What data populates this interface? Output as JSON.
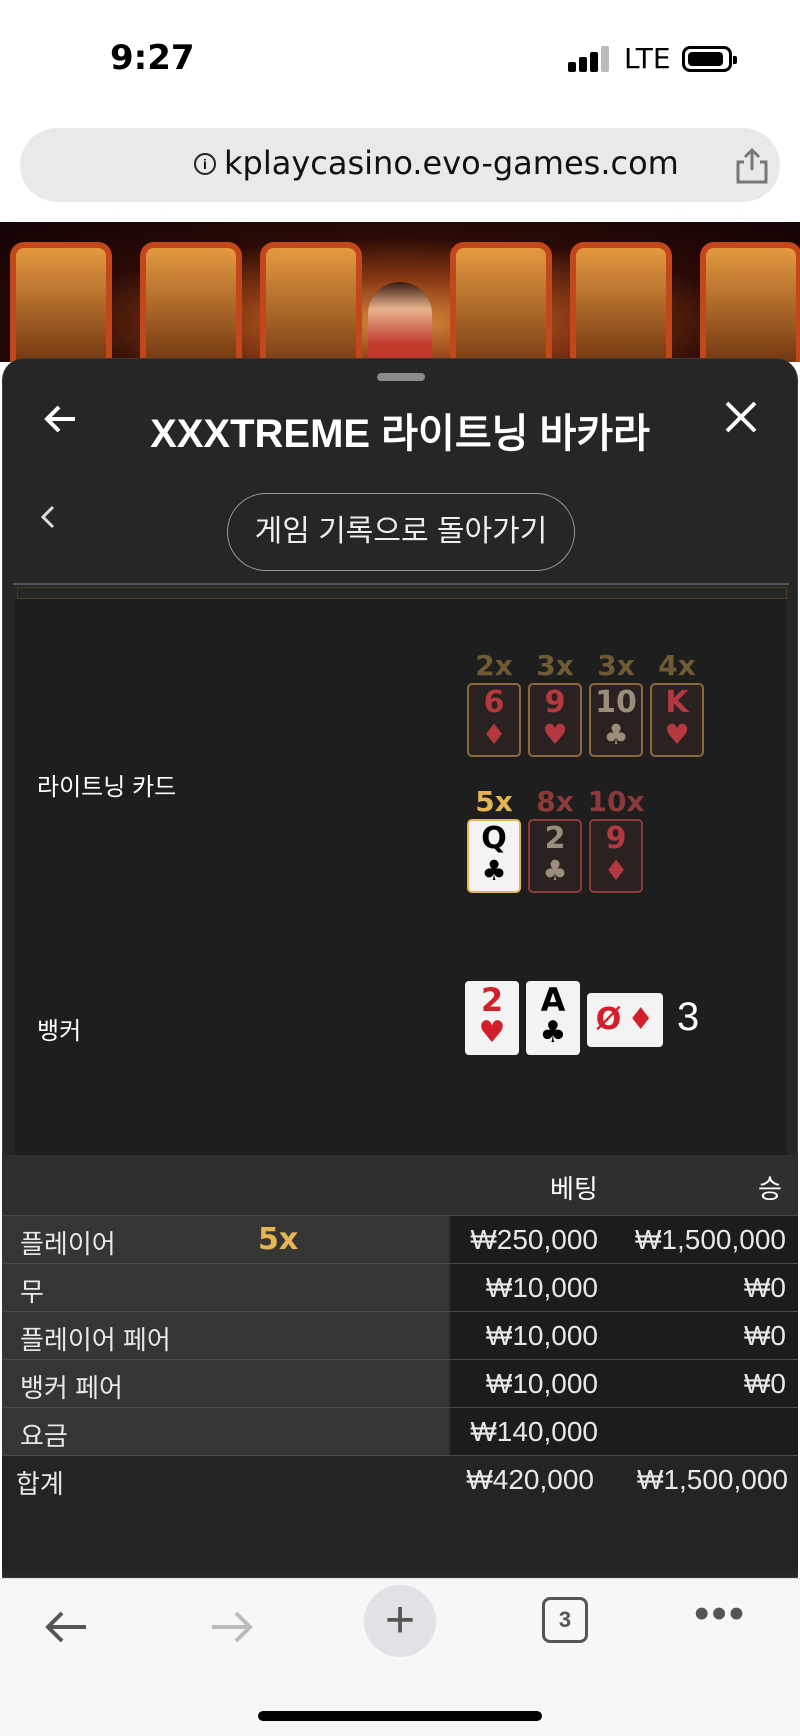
{
  "status_bar": {
    "time": "9:27",
    "network": "LTE"
  },
  "url_bar": {
    "url": "kplaycasino.evo-games.com"
  },
  "sheet": {
    "title": "XXXTREME 라이트닝 바카라",
    "history_button": "게임 기록으로 돌아가기"
  },
  "lightning": {
    "label": "라이트닝 카드",
    "row1": [
      {
        "mult": "2x",
        "rank": "6",
        "suit": "♦",
        "color": "#b3383f"
      },
      {
        "mult": "3x",
        "rank": "9",
        "suit": "♥",
        "color": "#b3383f"
      },
      {
        "mult": "3x",
        "rank": "10",
        "suit": "♣",
        "color": "#9a8d7a"
      },
      {
        "mult": "4x",
        "rank": "K",
        "suit": "♥",
        "color": "#b3383f"
      }
    ],
    "row2": [
      {
        "mult": "5x",
        "rank": "Q",
        "suit": "♣",
        "color": "#000000",
        "highlighted": true
      },
      {
        "mult": "8x",
        "rank": "2",
        "suit": "♣",
        "color": "#9a8d7a"
      },
      {
        "mult": "10x",
        "rank": "9",
        "suit": "♦",
        "color": "#b3383f"
      }
    ]
  },
  "banker": {
    "label": "뱅커",
    "cards": [
      {
        "rank": "2",
        "suit": "♥",
        "color": "#d21f2a"
      },
      {
        "rank": "A",
        "suit": "♣",
        "color": "#000000"
      }
    ],
    "side_card": {
      "rank": "Ø",
      "suit": "♦",
      "color": "#d21f2a"
    },
    "score": "3"
  },
  "bets_table": {
    "headers": {
      "bet": "베팅",
      "win": "승"
    },
    "rows": [
      {
        "label": "플레이어",
        "multiplier": "5x",
        "bet": "₩250,000",
        "win": "₩1,500,000"
      },
      {
        "label": "무",
        "bet": "₩10,000",
        "win": "₩0"
      },
      {
        "label": "플레이어 페어",
        "bet": "₩10,000",
        "win": "₩0"
      },
      {
        "label": "뱅커 페어",
        "bet": "₩10,000",
        "win": "₩0"
      },
      {
        "label": "요금",
        "bet": "₩140,000",
        "win": ""
      }
    ],
    "total": {
      "label": "합계",
      "bet": "₩420,000",
      "win": "₩1,500,000"
    }
  },
  "bottom_bar": {
    "tab_count": "3"
  },
  "colors": {
    "gold": "#e3b655",
    "sheet_bg": "#262626",
    "card_red": "#d21f2a"
  }
}
